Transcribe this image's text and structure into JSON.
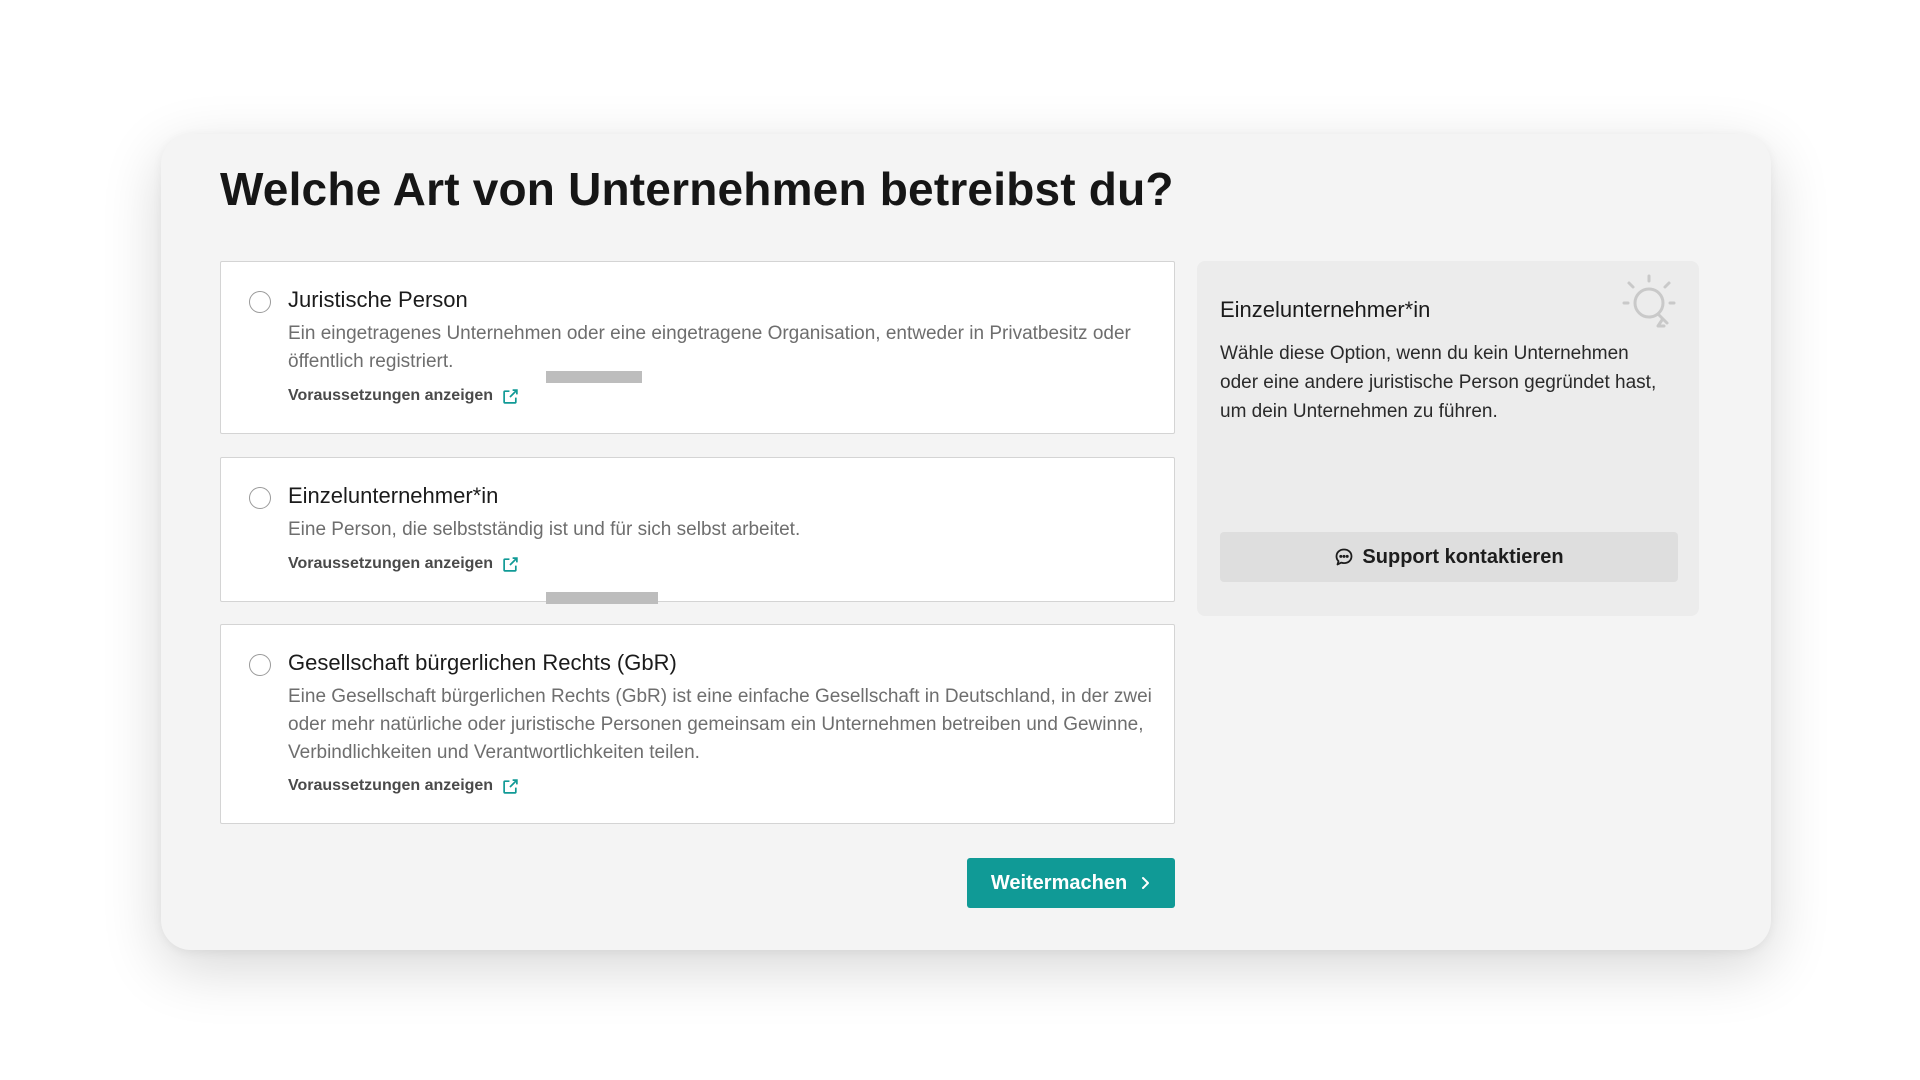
{
  "page": {
    "title": "Welche Art von Unternehmen betreibst du?"
  },
  "options": [
    {
      "title": "Juristische Person",
      "description": "Ein eingetragenes Unternehmen oder eine eingetragene Organisation, entweder in Privatbesitz oder öffentlich registriert.",
      "link": "Voraussetzungen anzeigen",
      "selected": false
    },
    {
      "title": "Einzelunternehmer*in",
      "description": "Eine Person, die selbstständig ist und für sich selbst arbeitet.",
      "link": "Voraussetzungen anzeigen",
      "selected": false
    },
    {
      "title": "Gesellschaft bürgerlichen Rechts (GbR)",
      "description": "Eine Gesellschaft bürgerlichen Rechts (GbR) ist eine einfache Gesellschaft in Deutschland, in der zwei oder mehr natürliche oder juristische Personen gemeinsam ein Unternehmen betreiben und Gewinne, Verbindlichkeiten und Verantwortlichkeiten teilen.",
      "link": "Voraussetzungen anzeigen",
      "selected": false
    }
  ],
  "actions": {
    "continue_label": "Weitermachen"
  },
  "info_panel": {
    "title": "Einzelunternehmer*in",
    "text": "Wähle diese Option, wenn du kein Unternehmen oder eine andere juristische Person gegründet hast, um dein Unternehmen zu führen.",
    "support_label": "Support kontaktieren",
    "icon": "lightbulb-icon"
  },
  "icons": {
    "link": "external-link-icon",
    "continue": "chevron-right-icon",
    "support": "chat-bubble-icon"
  },
  "colors": {
    "accent": "#109a96",
    "card_background": "#f4f4f4",
    "panel_background": "#ececec",
    "support_button": "#dedede"
  }
}
